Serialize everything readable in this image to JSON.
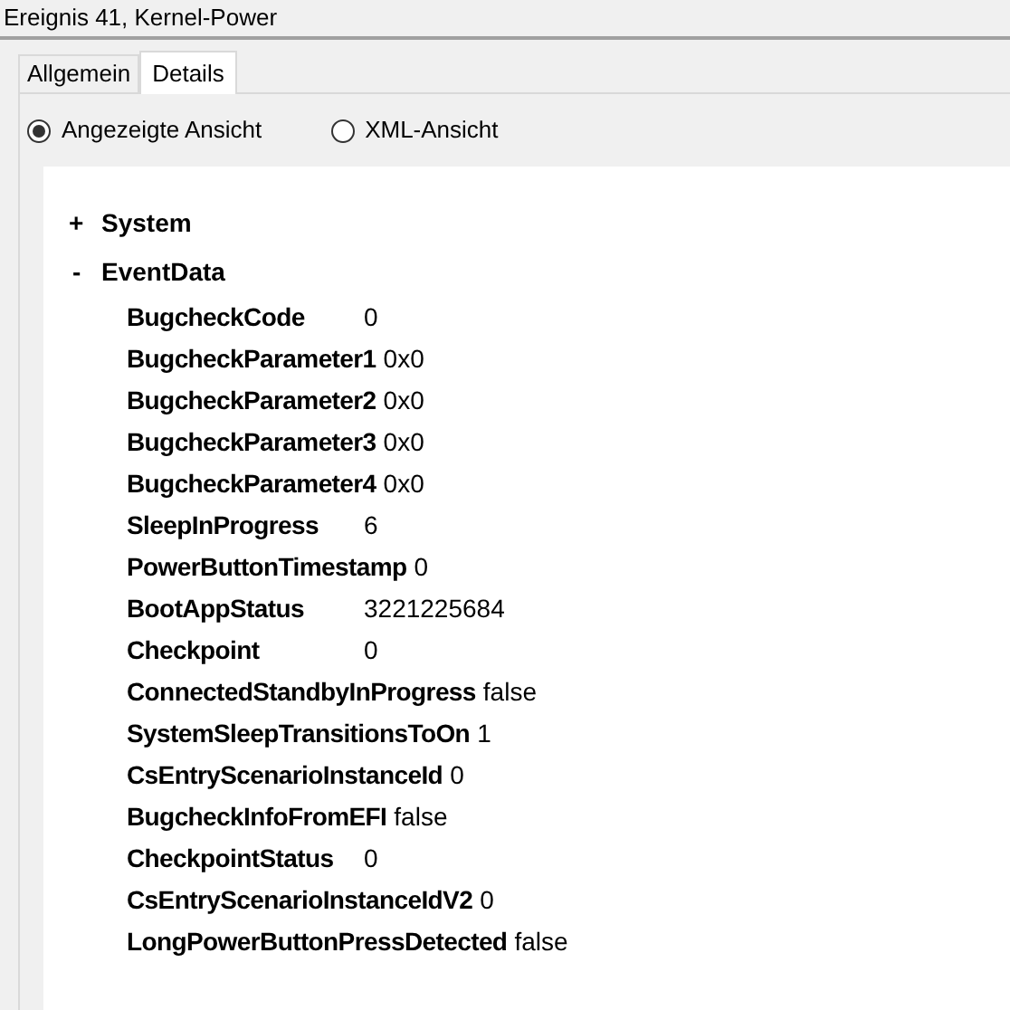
{
  "window": {
    "title": "Ereignis 41, Kernel-Power"
  },
  "tabs": [
    {
      "label": "Allgemein",
      "selected": false
    },
    {
      "label": "Details",
      "selected": true
    }
  ],
  "view_options": [
    {
      "label": "Angezeigte Ansicht",
      "selected": true
    },
    {
      "label": "XML-Ansicht",
      "selected": false
    }
  ],
  "tree": [
    {
      "toggle": "+",
      "label": "System",
      "expanded": false
    },
    {
      "toggle": "-",
      "label": "EventData",
      "expanded": true,
      "fields": [
        {
          "name": "BugcheckCode",
          "value": "0"
        },
        {
          "name": "BugcheckParameter1",
          "value": "0x0"
        },
        {
          "name": "BugcheckParameter2",
          "value": "0x0"
        },
        {
          "name": "BugcheckParameter3",
          "value": "0x0"
        },
        {
          "name": "BugcheckParameter4",
          "value": "0x0"
        },
        {
          "name": "SleepInProgress",
          "value": "6"
        },
        {
          "name": "PowerButtonTimestamp",
          "value": "0"
        },
        {
          "name": "BootAppStatus",
          "value": "3221225684"
        },
        {
          "name": "Checkpoint",
          "value": "0"
        },
        {
          "name": "ConnectedStandbyInProgress",
          "value": "false"
        },
        {
          "name": "SystemSleepTransitionsToOn",
          "value": "1"
        },
        {
          "name": "CsEntryScenarioInstanceId",
          "value": "0"
        },
        {
          "name": "BugcheckInfoFromEFI",
          "value": "false"
        },
        {
          "name": "CheckpointStatus",
          "value": "0"
        },
        {
          "name": "CsEntryScenarioInstanceIdV2",
          "value": "0"
        },
        {
          "name": "LongPowerButtonPressDetected",
          "value": "false"
        }
      ]
    }
  ]
}
